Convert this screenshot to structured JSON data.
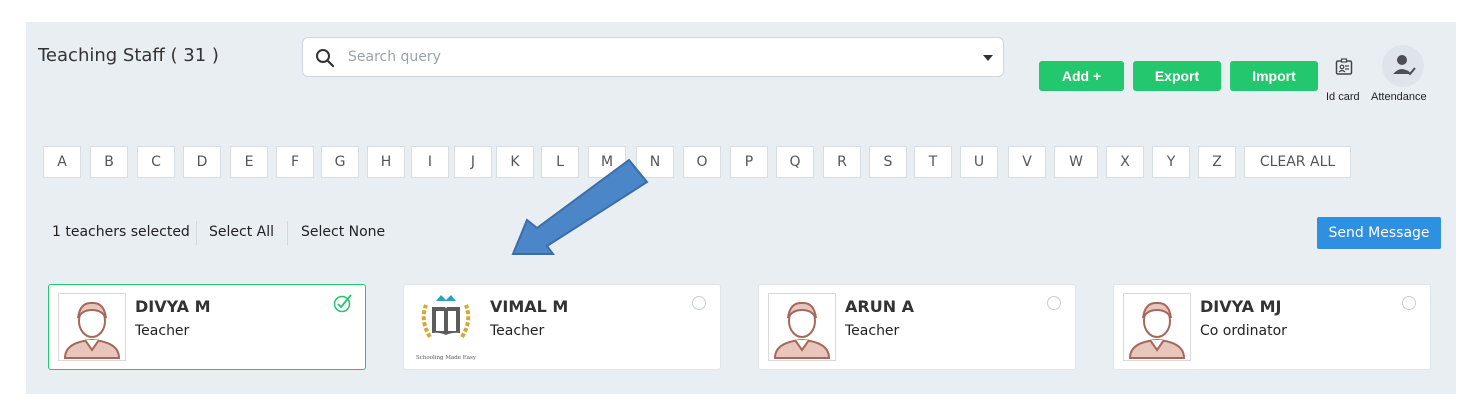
{
  "header": {
    "title": "Teaching Staff ( 31 )",
    "search_placeholder": "Search query",
    "buttons": {
      "add": "Add +",
      "export": "Export",
      "import": "Import"
    },
    "id_card_label": "Id card",
    "attendance_label": "Attendance"
  },
  "alphabet": [
    "A",
    "B",
    "C",
    "D",
    "E",
    "F",
    "G",
    "H",
    "I",
    "J",
    "K",
    "L",
    "M",
    "N",
    "O",
    "P",
    "Q",
    "R",
    "S",
    "T",
    "U",
    "V",
    "W",
    "X",
    "Y",
    "Z"
  ],
  "clear_all": "CLEAR ALL",
  "selection": {
    "count_text": "1 teachers selected",
    "select_all": "Select All",
    "select_none": "Select None",
    "send_message": "Send Message"
  },
  "cards": [
    {
      "name": "DIVYA M",
      "role": "Teacher",
      "selected": true,
      "avatar": "person-avatar"
    },
    {
      "name": "VIMAL M",
      "role": "Teacher",
      "selected": false,
      "avatar": "school-logo",
      "logo_caption": "Schooling Made Easy"
    },
    {
      "name": "ARUN A",
      "role": "Teacher",
      "selected": false,
      "avatar": "person-avatar"
    },
    {
      "name": "DIVYA MJ",
      "role": "Co ordinator",
      "selected": false,
      "avatar": "person-avatar"
    }
  ],
  "colors": {
    "primary_green": "#22c76e",
    "send_blue": "#2f8fe0",
    "arrow_blue": "#4a86c8",
    "panel_bg": "#e9eef3"
  }
}
